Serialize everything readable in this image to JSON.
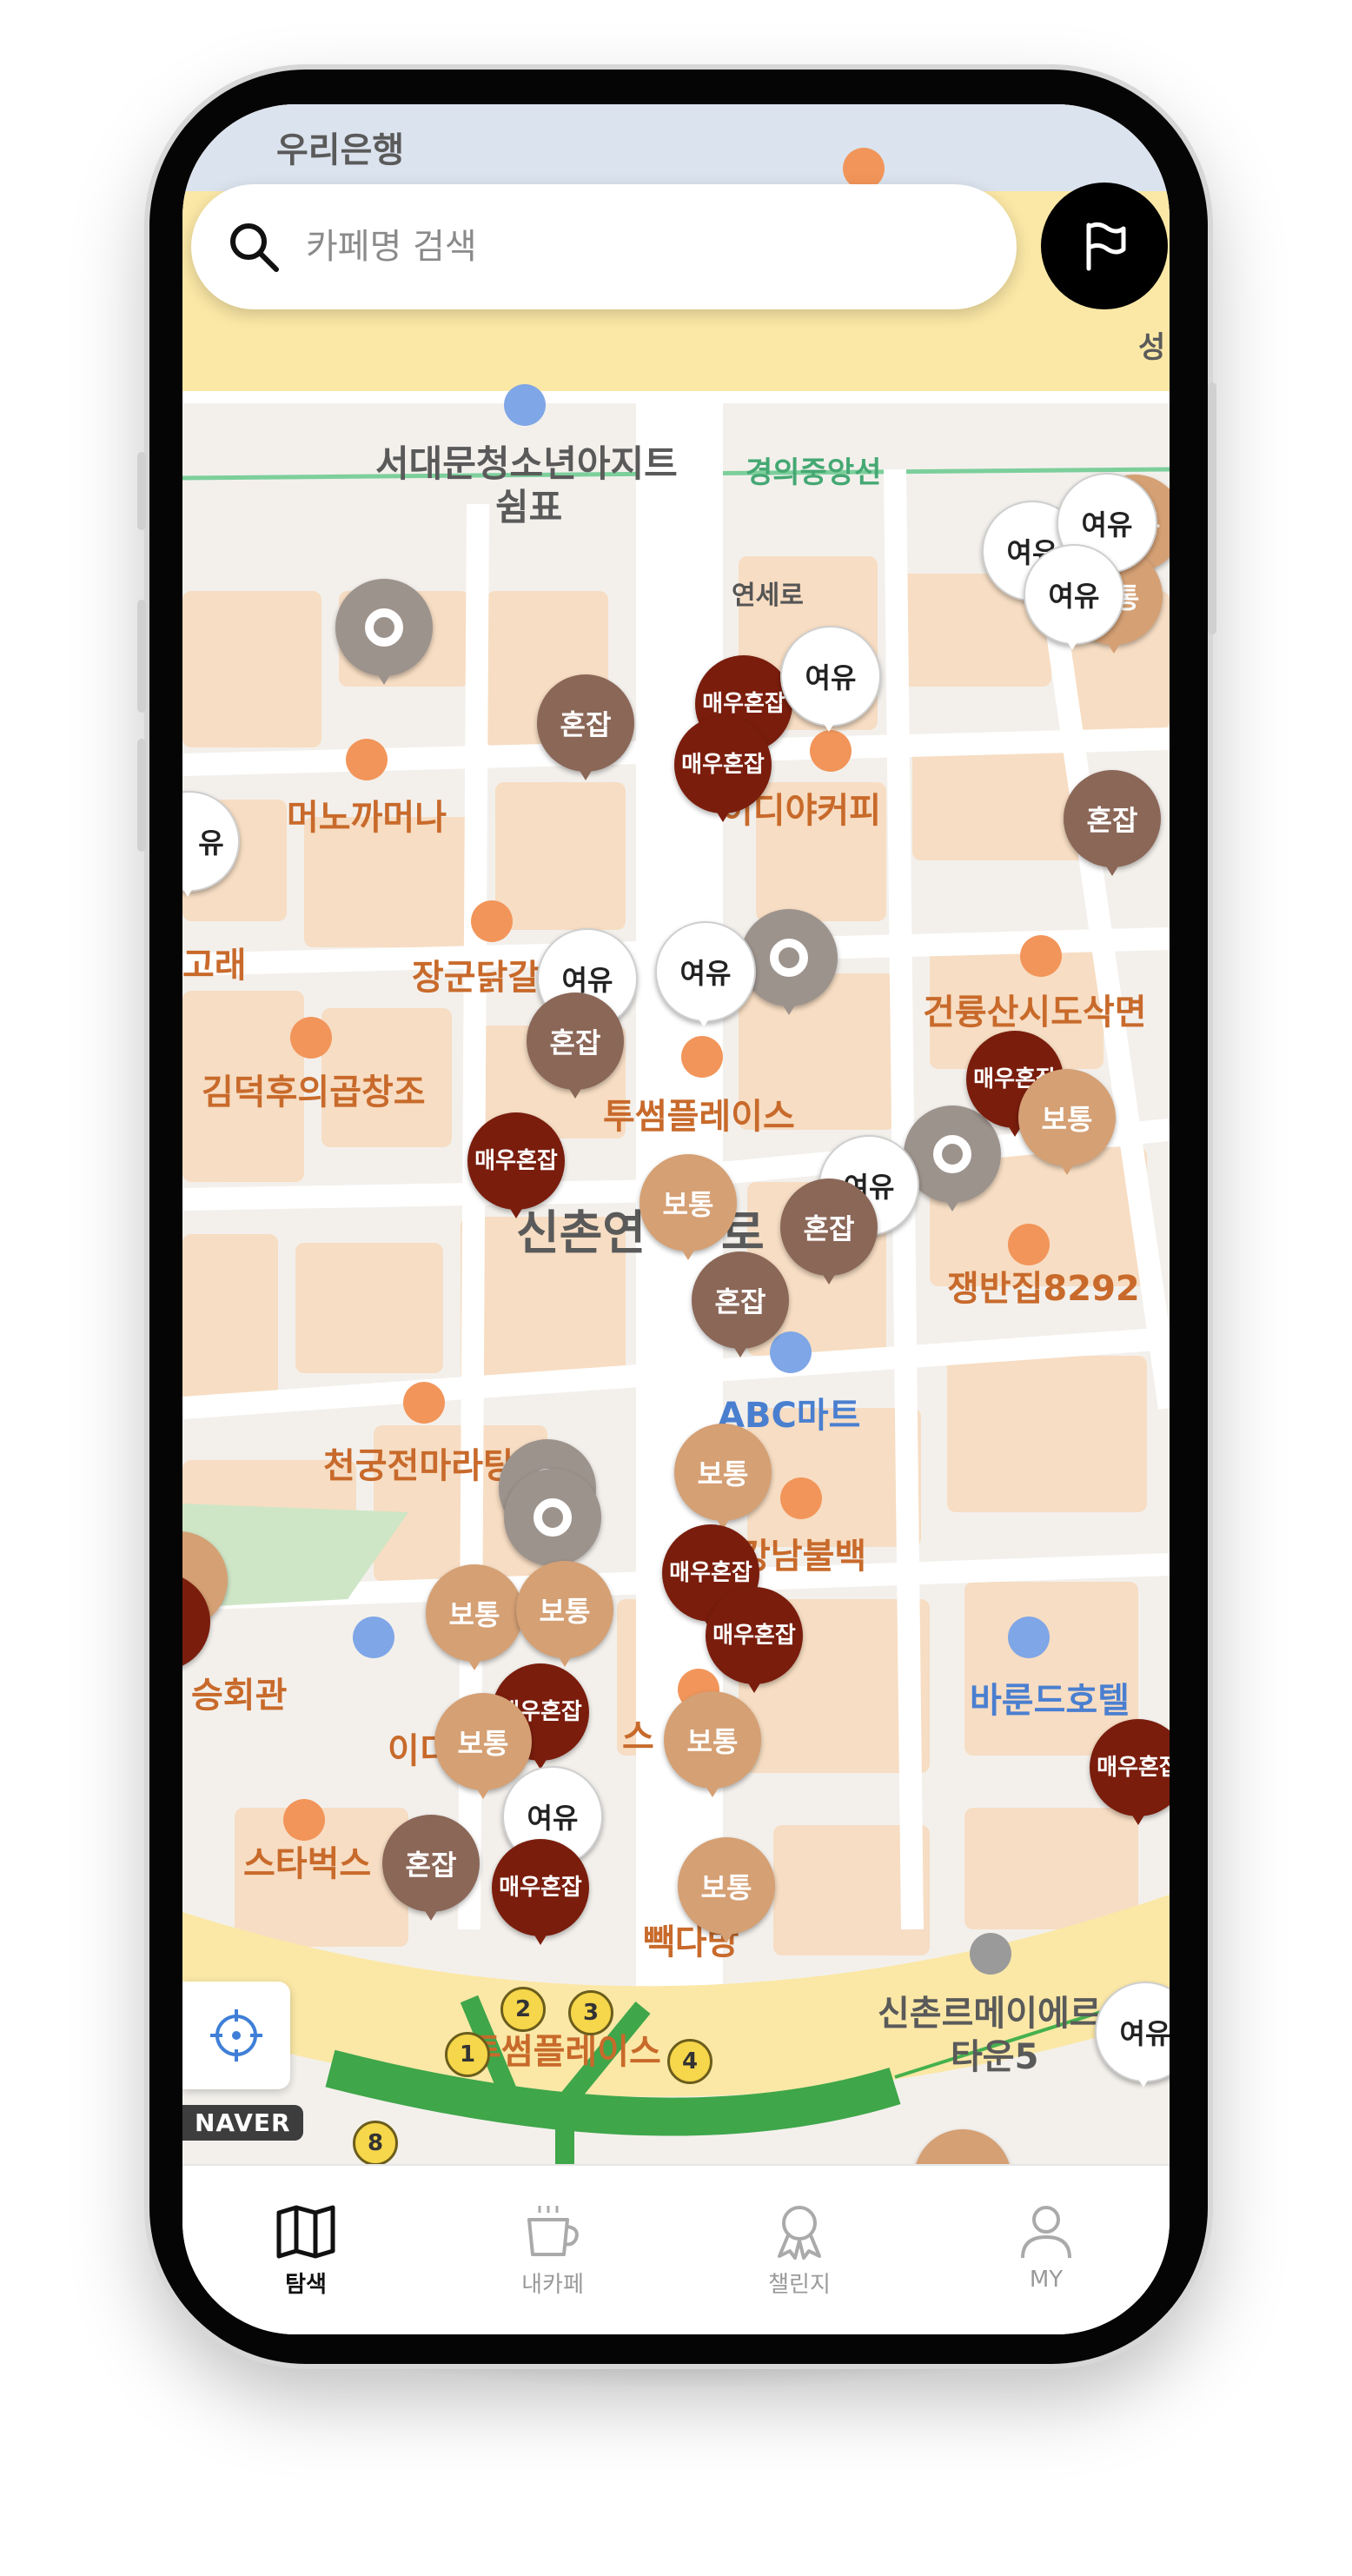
{
  "search": {
    "placeholder": "카페명 검색"
  },
  "icons": {
    "search": "search-icon",
    "flag": "flag-icon",
    "locate": "crosshair-icon"
  },
  "map_labels": {
    "woori": "우리은행",
    "seodaemun": "서대문청소년아지트",
    "swimpyo": "쉼표",
    "gyeongui": "경의중앙선",
    "yonsei": "연세로",
    "seong": "성",
    "manokkamana": "머노까머나",
    "idiya": "이디야커피",
    "gorae": "고래",
    "janggundak": "장군닭갈",
    "geonryung": "건륭산시도삭면",
    "kimdeokhu": "김덕후의곱창조",
    "twosome": "투썸플레이스",
    "sinchon": "신촌연",
    "sinchon_end": "로",
    "jaengban": "쟁반집8292",
    "abc": "ABC마트",
    "cheongung": "천궁전마라탕",
    "gangnam": "강남불백",
    "seunghoe": "승회관",
    "barundeu": "바룬드호텔",
    "idi": "이디",
    "starbucks": "스타벅스",
    "ppaeda": "빽다방",
    "seu": "스",
    "meierne": "신촌르메이에르",
    "town5": "타운5",
    "twosome2": "투썸플레이스",
    "yu": "유",
    "naver": "NAVER"
  },
  "pins": {
    "honjab": "혼잡",
    "maeu_line1": "매우",
    "maeu_line2": "혼잡",
    "botong": "보통",
    "yeoyu": "여유"
  },
  "stations": [
    "1",
    "2",
    "3",
    "4",
    "8"
  ],
  "tabs": [
    {
      "label": "탐색",
      "icon": "map-icon",
      "active": true
    },
    {
      "label": "내카페",
      "icon": "coffee-cup-icon",
      "active": false
    },
    {
      "label": "챌린지",
      "icon": "badge-icon",
      "active": false
    },
    {
      "label": "MY",
      "icon": "user-icon",
      "active": false
    }
  ],
  "colors": {
    "honjab": "#8b6758",
    "maeu_honjab": "#7a1d0d",
    "botong": "#d5a074",
    "yeoyu": "#ffffff",
    "accent": "#000000"
  }
}
